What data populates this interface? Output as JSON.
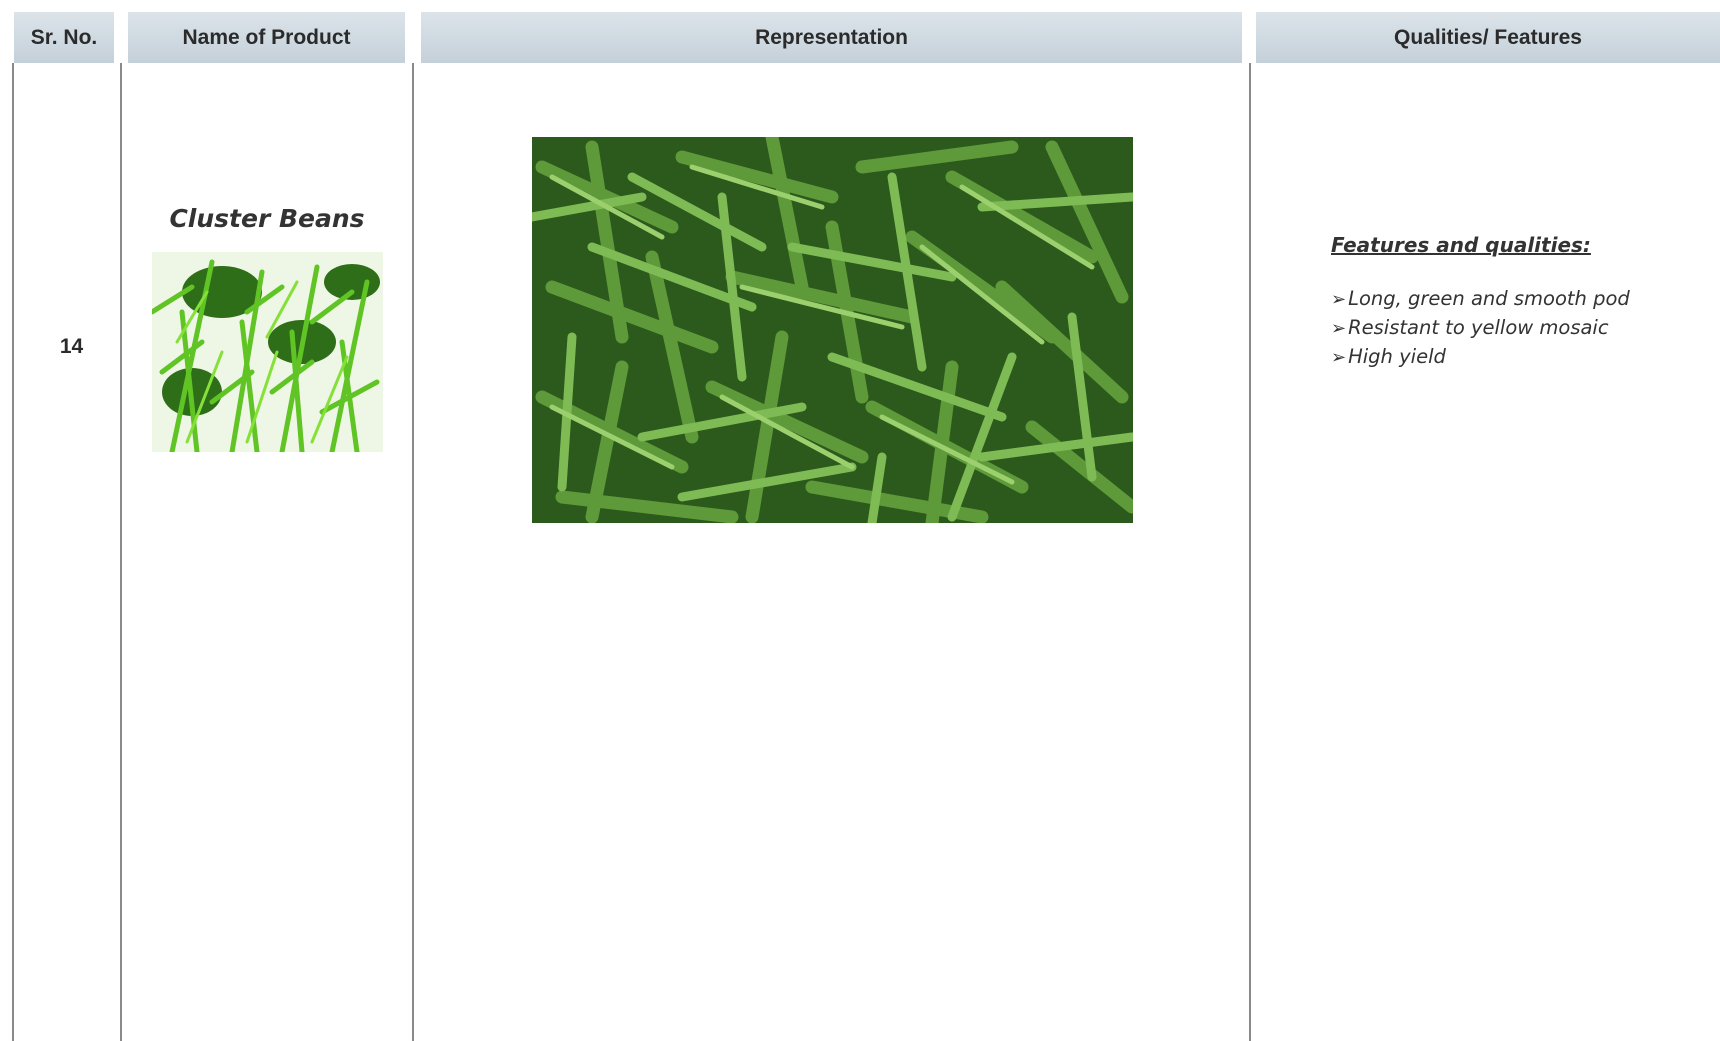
{
  "table": {
    "headers": {
      "sr_no": "Sr. No.",
      "name": "Name of Product",
      "representation": "Representation",
      "features": "Qualities/ Features"
    },
    "row": {
      "sr_no": "14",
      "product_name": "Cluster Beans",
      "features_title": "Features and qualities:",
      "features": [
        "Long, green and smooth pod",
        "Resistant to yellow mosaic",
        "High yield"
      ]
    }
  },
  "icons": {
    "bullet": "arrowhead-bullet-icon"
  },
  "colors": {
    "header_bg": "#c9d4dc",
    "divider": "#8a8a8a",
    "text": "#333333"
  }
}
